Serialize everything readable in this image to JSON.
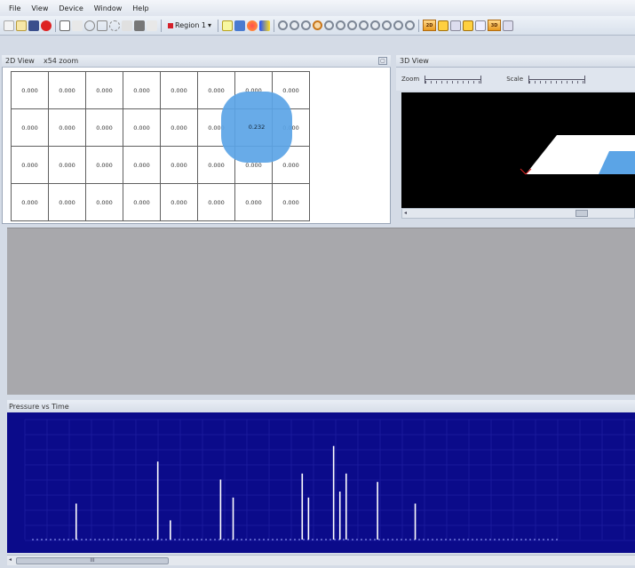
{
  "menu": {
    "items": [
      "File",
      "View",
      "Device",
      "Window",
      "Help"
    ]
  },
  "toolbar": {
    "region_label": "Region 1",
    "region_color": "#d4202a"
  },
  "view2d": {
    "title": "2D View",
    "zoom": "x54 zoom",
    "close_glyph": "▢",
    "grid_rows": [
      [
        "0.000",
        "0.000",
        "0.000",
        "0.000",
        "0.000",
        "0.000",
        "0.000",
        "0.000"
      ],
      [
        "0.000",
        "0.000",
        "0.000",
        "0.000",
        "0.000",
        "0.000",
        "0.232",
        "0.000"
      ],
      [
        "0.000",
        "0.000",
        "0.000",
        "0.000",
        "0.000",
        "0.000",
        "0.000",
        "0.000"
      ],
      [
        "0.000",
        "0.000",
        "0.000",
        "0.000",
        "0.000",
        "0.000",
        "0.000",
        "0.000"
      ]
    ],
    "highlight_color": "#5ba4e6"
  },
  "view3d": {
    "title": "3D View",
    "zoom_label": "Zoom",
    "scale_label": "Scale",
    "scroll_arrow": "◂",
    "scroll_thumb": "III"
  },
  "pressure": {
    "title": "Pressure vs Time",
    "bg_color": "#0b0b8a"
  },
  "hscroll": {
    "arrow": "◂",
    "thumb": "III"
  },
  "chart_data": {
    "type": "line",
    "title": "Pressure vs Time",
    "series": [
      {
        "values": [
          {
            "x": 0.11,
            "y": 0.3
          },
          {
            "x": 0.24,
            "y": 0.65
          },
          {
            "x": 0.26,
            "y": 0.16
          },
          {
            "x": 0.34,
            "y": 0.5
          },
          {
            "x": 0.36,
            "y": 0.35
          },
          {
            "x": 0.47,
            "y": 0.55
          },
          {
            "x": 0.48,
            "y": 0.35
          },
          {
            "x": 0.52,
            "y": 0.78
          },
          {
            "x": 0.53,
            "y": 0.4
          },
          {
            "x": 0.54,
            "y": 0.55
          },
          {
            "x": 0.59,
            "y": 0.48
          },
          {
            "x": 0.65,
            "y": 0.3
          }
        ]
      }
    ]
  }
}
